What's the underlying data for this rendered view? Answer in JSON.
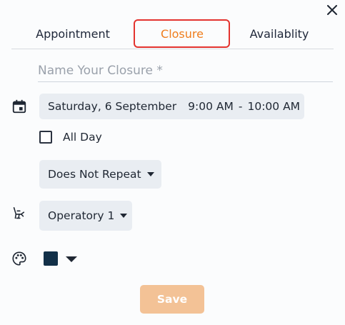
{
  "tabs": [
    {
      "label": "Appointment",
      "active": false
    },
    {
      "label": "Closure",
      "active": true
    },
    {
      "label": "Availablity",
      "active": false
    }
  ],
  "colors": {
    "accent": "#ef7d1c",
    "highlight": "#e3342f",
    "swatch": "#123048",
    "save_bg": "#f3c296"
  },
  "form": {
    "name_placeholder": "Name Your Closure *",
    "name_value": "",
    "date": "Saturday, 6 September",
    "start_time": "9:00 AM",
    "separator": "-",
    "end_time": "10:00 AM",
    "all_day_label": "All Day",
    "all_day_checked": false,
    "repeat_value": "Does Not Repeat",
    "operator_value": "Operatory 1",
    "save_label": "Save"
  },
  "icons": {
    "close": "close-icon",
    "date": "calendar-icon",
    "operator": "dental-chair-icon",
    "color": "palette-icon"
  }
}
